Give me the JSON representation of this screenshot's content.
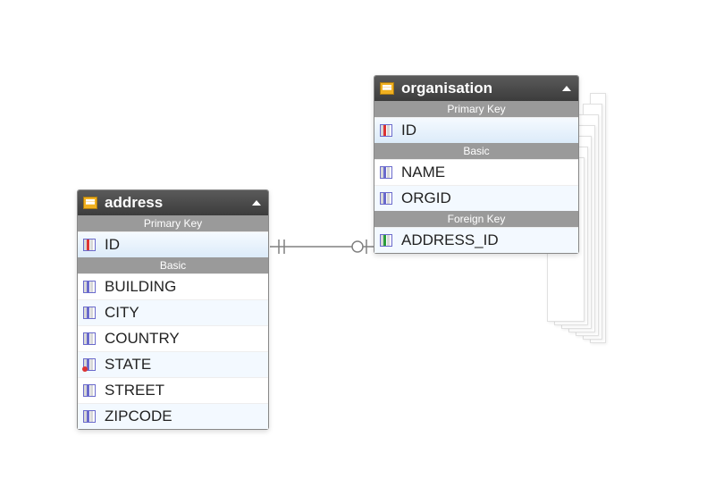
{
  "entities": {
    "address": {
      "title": "address",
      "sections": {
        "primary_key": {
          "label": "Primary Key",
          "fields": [
            {
              "name": "ID",
              "icon": "pk"
            }
          ]
        },
        "basic": {
          "label": "Basic",
          "fields": [
            {
              "name": "BUILDING",
              "icon": "col"
            },
            {
              "name": "CITY",
              "icon": "col"
            },
            {
              "name": "COUNTRY",
              "icon": "col"
            },
            {
              "name": "STATE",
              "icon": "state"
            },
            {
              "name": "STREET",
              "icon": "col"
            },
            {
              "name": "ZIPCODE",
              "icon": "col"
            }
          ]
        }
      }
    },
    "organisation": {
      "title": "organisation",
      "sections": {
        "primary_key": {
          "label": "Primary Key",
          "fields": [
            {
              "name": "ID",
              "icon": "pk"
            }
          ]
        },
        "basic": {
          "label": "Basic",
          "fields": [
            {
              "name": "NAME",
              "icon": "col"
            },
            {
              "name": "ORGID",
              "icon": "col"
            }
          ]
        },
        "foreign_key": {
          "label": "Foreign Key",
          "fields": [
            {
              "name": "ADDRESS_ID",
              "icon": "fk"
            }
          ]
        }
      }
    }
  },
  "relationship": {
    "from": {
      "entity": "address",
      "field": "ID",
      "cardinality": "one"
    },
    "to": {
      "entity": "organisation",
      "field": "ADDRESS_ID",
      "cardinality": "zero-or-one"
    }
  }
}
